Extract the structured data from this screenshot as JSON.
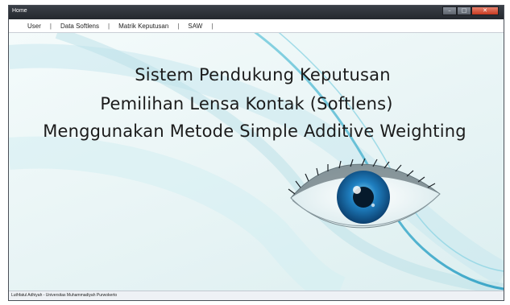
{
  "window": {
    "title": "Home",
    "controls": {
      "minimize": "–",
      "maximize": "□",
      "close": "✕"
    }
  },
  "menu": {
    "items": [
      "User",
      "Data Softlens",
      "Matrik Keputusan",
      "SAW"
    ],
    "separator": "|"
  },
  "main": {
    "heading_line1": "Sistem Pendukung Keputusan",
    "heading_line2": "Pemilihan Lensa Kontak (Softlens)",
    "heading_line3": "Menggunakan Metode Simple Additive Weighting"
  },
  "status": {
    "text": "Luthfatul Adhiyah - Universitas Muhammadiyah Purwokerto"
  },
  "colors": {
    "titlebar": "#2e3238",
    "background": "#e8f4f5",
    "iris": "#1f7fc0",
    "swirl": "#35a9c9"
  },
  "icons": {
    "eye": "eye-icon"
  }
}
